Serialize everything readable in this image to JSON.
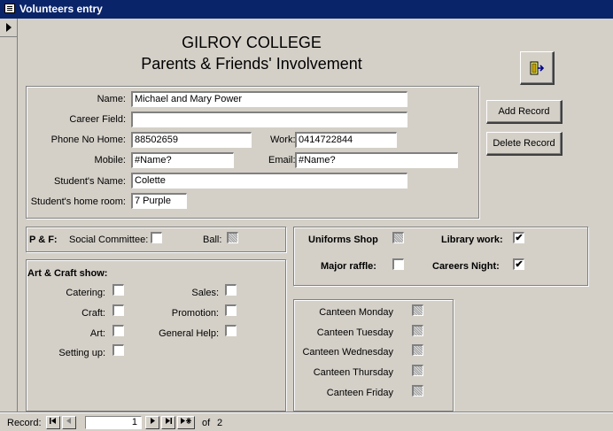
{
  "window": {
    "title": "Volunteers entry"
  },
  "header": {
    "line1": "GILROY COLLEGE",
    "line2": "Parents & Friends' Involvement"
  },
  "buttons": {
    "add_record": "Add Record",
    "delete_record": "Delete Record",
    "exit_icon": "exit-door-icon"
  },
  "contact": {
    "name_label": "Name:",
    "name_value": "Michael and Mary Power",
    "career_label": "Career Field:",
    "career_value": "",
    "phone_home_label": "Phone No Home:",
    "phone_home_value": "88502659",
    "work_label": "Work:",
    "work_value": "0414722844",
    "mobile_label": "Mobile:",
    "mobile_value": "#Name?",
    "email_label": "Email:",
    "email_value": "#Name?",
    "student_name_label": "Student's Name:",
    "student_name_value": "Colette",
    "home_room_label": "Student's home room:",
    "home_room_value": "7 Purple"
  },
  "pf": {
    "title": "P & F:",
    "social_label": "Social Committee:",
    "social_checked": false,
    "ball_label": "Ball:",
    "ball_checked": null
  },
  "art_craft": {
    "title": "Art & Craft show:",
    "catering_label": "Catering:",
    "craft_label": "Craft:",
    "art_label": "Art:",
    "setting_up_label": "Setting up:",
    "sales_label": "Sales:",
    "promotion_label": "Promotion:",
    "general_help_label": "General Help:"
  },
  "activities": {
    "uniforms_label": "Uniforms Shop",
    "uniforms_checked": null,
    "library_label": "Library work:",
    "library_checked": true,
    "raffle_label": "Major raffle:",
    "raffle_checked": false,
    "careers_label": "Careers Night:",
    "careers_checked": true
  },
  "canteen": {
    "monday": "Canteen Monday",
    "tuesday": "Canteen Tuesday",
    "wednesday": "Canteen Wednesday",
    "thursday": "Canteen Thursday",
    "friday": "Canteen Friday"
  },
  "navigation": {
    "record_label": "Record:",
    "current": "1",
    "of_label": "of",
    "total": "2"
  },
  "check_mark": "✔"
}
